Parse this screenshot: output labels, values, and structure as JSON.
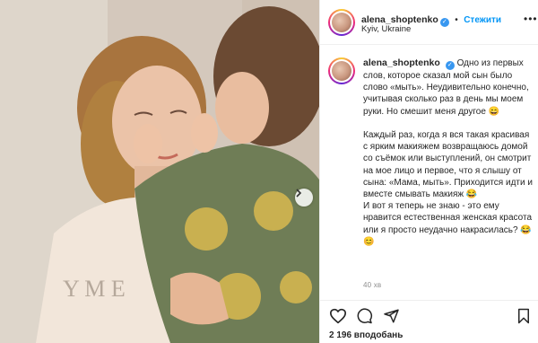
{
  "post": {
    "author": "alena_shoptenko",
    "follow_label": "Стежити",
    "separator": "•",
    "location": "Kyiv, Ukraine",
    "more_label": "•••",
    "caption": "Одно из первых слов, которое сказал мой сын было слово «мыть». Неудивительно конечно, учитывая сколько раз в день мы моем руки. Но смешит меня другое 😄\n\nКаждый раз, когда я вся такая красивая с ярким макияжем возвращаюсь домой со съёмок или выступлений, он смотрит на мое лицо и первое, что я слышу от сына: «Мама, мыть». Приходится идти и вместе смывать макияж 😂\nИ вот я теперь не знаю - это ему нравится естественная женская красота или я просто неудачно накрасилась? 😂😊",
    "time_ago": "40 хв",
    "likes": "2 196 вподобань",
    "verified_icon": "verified-badge-icon",
    "colors": {
      "accent": "#0095f6",
      "verified": "#3897f0",
      "muted": "#8e8e8e",
      "text": "#262626"
    }
  },
  "icons": {
    "like": "heart-icon",
    "comment": "comment-icon",
    "share": "share-icon",
    "save": "bookmark-icon",
    "carousel_next": "chevron-right-icon"
  }
}
